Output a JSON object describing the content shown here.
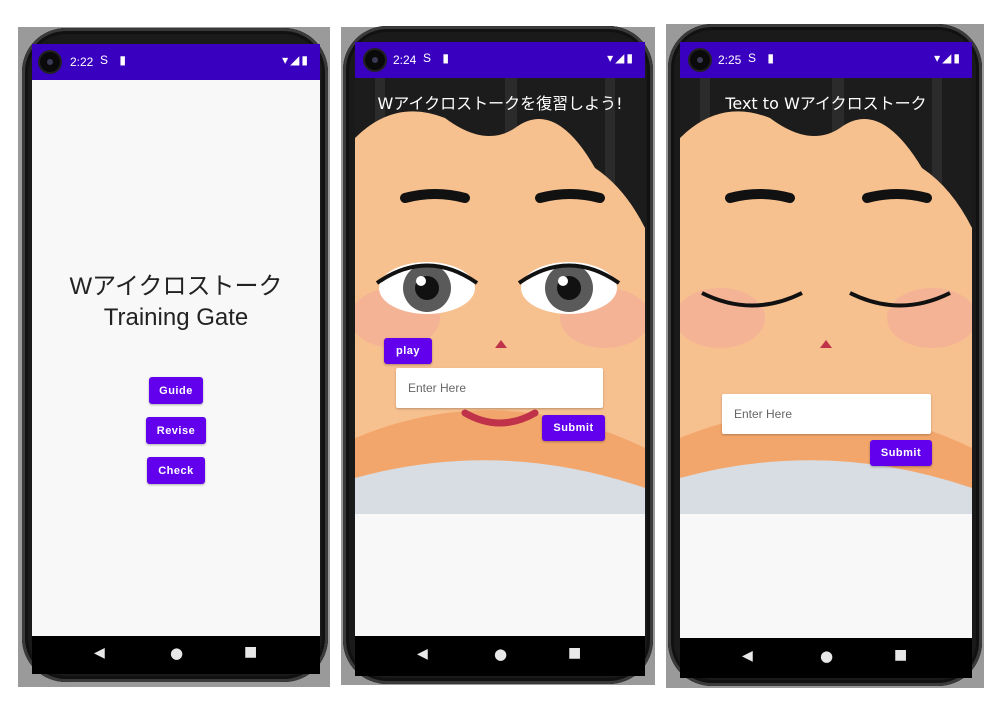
{
  "colors": {
    "status_bar": "#3a00bf",
    "button": "#6200ee",
    "screen_bg": "#f8f8f8",
    "skin": "#f7c08f",
    "hair": "#1a1a1a"
  },
  "screen1": {
    "status": {
      "time": "2:22",
      "left_icons": "S ▮",
      "right_icons": "▾◢▮"
    },
    "title_line1": "Wアイクロストーク",
    "title_line2": "Training Gate",
    "buttons": {
      "guide": "Guide",
      "revise": "Revise",
      "check": "Check"
    },
    "nav": {
      "back": "◀",
      "home": "●",
      "recents": "■"
    }
  },
  "screen2": {
    "status": {
      "time": "2:24",
      "left_icons": "S ▮",
      "right_icons": "▾◢▮"
    },
    "title": "Wアイクロストークを復習しよう!",
    "play_label": "play",
    "input_placeholder": "Enter Here",
    "submit_label": "Submit",
    "nav": {
      "back": "◀",
      "home": "●",
      "recents": "■"
    }
  },
  "screen3": {
    "status": {
      "time": "2:25",
      "left_icons": "S ▮",
      "right_icons": "▾◢▮"
    },
    "title": "Text to Wアイクロストーク",
    "input_placeholder": "Enter Here",
    "submit_label": "Submit",
    "nav": {
      "back": "◀",
      "home": "●",
      "recents": "■"
    }
  }
}
